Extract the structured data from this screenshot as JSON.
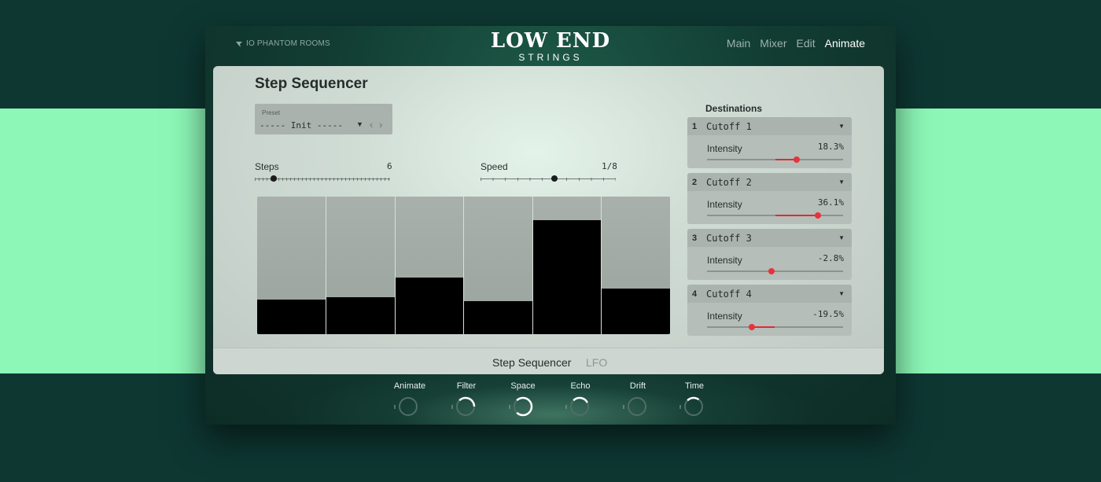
{
  "vendor": "IO PHANTOM ROOMS",
  "logo": {
    "title": "LOW END",
    "subtitle": "STRINGS"
  },
  "nav": {
    "items": [
      "Main",
      "Mixer",
      "Edit",
      "Animate"
    ],
    "active": "Animate"
  },
  "panel": {
    "title": "Step Sequencer",
    "preset": {
      "label": "Preset",
      "value": "----- Init -----"
    },
    "steps": {
      "label": "Steps",
      "value": "6"
    },
    "speed": {
      "label": "Speed",
      "value": "1/8"
    },
    "sequence_levels": [
      0.25,
      0.27,
      0.41,
      0.24,
      0.83,
      0.33
    ]
  },
  "destinations": {
    "title": "Destinations",
    "items": [
      {
        "num": "1",
        "name": "Cutoff 1",
        "intensity_label": "Intensity",
        "intensity": "18.3%",
        "value": 18.3
      },
      {
        "num": "2",
        "name": "Cutoff 2",
        "intensity_label": "Intensity",
        "intensity": "36.1%",
        "value": 36.1
      },
      {
        "num": "3",
        "name": "Cutoff 3",
        "intensity_label": "Intensity",
        "intensity": "-2.8%",
        "value": -2.8
      },
      {
        "num": "4",
        "name": "Cutoff 4",
        "intensity_label": "Intensity",
        "intensity": "-19.5%",
        "value": -19.5
      }
    ]
  },
  "tabs": {
    "items": [
      "Step Sequencer",
      "LFO"
    ],
    "active": "Step Sequencer"
  },
  "macros": [
    {
      "label": "Animate",
      "level": 0.0
    },
    {
      "label": "Filter",
      "level": 0.5
    },
    {
      "label": "Space",
      "level": 1.0
    },
    {
      "label": "Echo",
      "level": 0.4
    },
    {
      "label": "Drift",
      "level": 0.0
    },
    {
      "label": "Time",
      "level": 0.3
    }
  ],
  "colors": {
    "accent": "#e02a35",
    "background": "#0e3732",
    "band": "#8cf7b6"
  }
}
